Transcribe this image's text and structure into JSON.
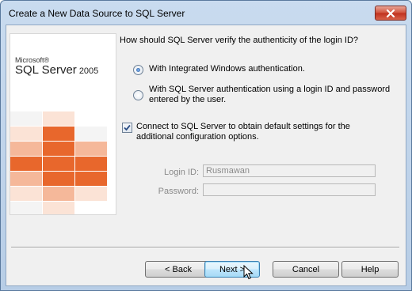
{
  "window": {
    "title": "Create a New Data Source to SQL Server"
  },
  "banner": {
    "brand_small": "Microsoft®",
    "brand_product": "SQL Server",
    "brand_year": "2005",
    "tile_colors": [
      "#e8672c",
      "#f5b89a",
      "#fbe3d6",
      "#f2f2f2"
    ]
  },
  "auth": {
    "question": "How should SQL Server verify the authenticity of the login ID?",
    "options": [
      {
        "label": "With Integrated Windows authentication.",
        "selected": true
      },
      {
        "label_line1": "With SQL Server authentication using a login ID and password",
        "label_line2": "entered by the user.",
        "selected": false
      }
    ]
  },
  "connect": {
    "checked": true,
    "label_line1": "Connect to SQL Server to obtain default settings for the",
    "label_line2": "additional configuration options."
  },
  "credentials": {
    "login_label": "Login ID:",
    "login_value": "Rusmawan",
    "password_label": "Password:",
    "password_value": ""
  },
  "buttons": {
    "back": "< Back",
    "next": "Next >",
    "cancel": "Cancel",
    "help": "Help"
  }
}
